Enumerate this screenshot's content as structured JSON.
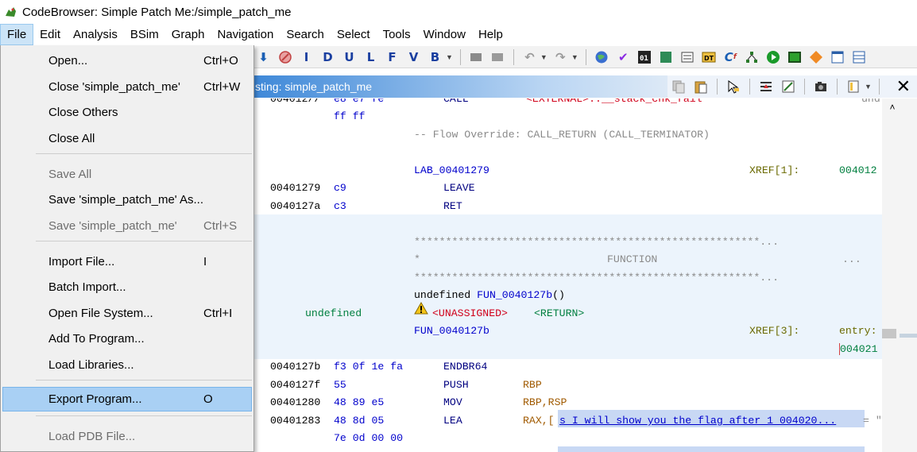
{
  "window": {
    "title": "CodeBrowser: Simple Patch Me:/simple_patch_me"
  },
  "menubar": {
    "items": [
      "File",
      "Edit",
      "Analysis",
      "BSim",
      "Graph",
      "Navigation",
      "Search",
      "Select",
      "Tools",
      "Window",
      "Help"
    ]
  },
  "file_menu": {
    "items": [
      {
        "label": "Open...",
        "shortcut": "Ctrl+O",
        "enabled": true
      },
      {
        "label": "Close 'simple_patch_me'",
        "shortcut": "Ctrl+W",
        "enabled": true
      },
      {
        "label": "Close Others",
        "shortcut": "",
        "enabled": true
      },
      {
        "label": "Close All",
        "shortcut": "",
        "enabled": true
      },
      {
        "label": "Save All",
        "shortcut": "",
        "enabled": false
      },
      {
        "label": "Save 'simple_patch_me' As...",
        "shortcut": "",
        "enabled": true
      },
      {
        "label": "Save 'simple_patch_me'",
        "shortcut": "Ctrl+S",
        "enabled": false
      },
      {
        "label": "Import File...",
        "shortcut": "I",
        "enabled": true
      },
      {
        "label": "Batch Import...",
        "shortcut": "",
        "enabled": true
      },
      {
        "label": "Open File System...",
        "shortcut": "Ctrl+I",
        "enabled": true
      },
      {
        "label": "Add To Program...",
        "shortcut": "",
        "enabled": true
      },
      {
        "label": "Load Libraries...",
        "shortcut": "",
        "enabled": true
      },
      {
        "label": "Export Program...",
        "shortcut": "O",
        "enabled": true,
        "selected": true
      },
      {
        "label": "Load PDB File...",
        "shortcut": "",
        "enabled": false
      }
    ]
  },
  "toolbar": {
    "letter_buttons": [
      "I",
      "D",
      "U",
      "L",
      "F",
      "V",
      "B"
    ]
  },
  "listing": {
    "title": "sting:  simple_patch_me",
    "lines": {
      "l0_addr": "004012//",
      "l0_bytes": "e8 e7 fe",
      "l0_mnem": "CALL",
      "l0_op": "<EXTERNAL>::__stack_chk_fail",
      "l0_tail": "und",
      "l1_bytes": "ff ff",
      "l2_comment": "-- Flow Override: CALL_RETURN (CALL_TERMINATOR)",
      "l3_label": "LAB_00401279",
      "l3_xref": "XREF[1]:",
      "l3_xref_addr": "004012",
      "l4_addr": "00401279",
      "l4_bytes": "c9",
      "l4_mnem": "LEAVE",
      "l5_addr": "0040127a",
      "l5_bytes": "c3",
      "l5_mnem": "RET",
      "l6_stars": "*******************************************************...",
      "l7_star": "*",
      "l7_func": "FUNCTION",
      "l7_dots": "...",
      "l8_stars": "*******************************************************...",
      "l9_sig_type": "undefined ",
      "l9_sig_name": "FUN_0040127b",
      "l9_sig_args": "()",
      "l10_type": "undefined",
      "l10_unassigned": "<UNASSIGNED>",
      "l10_return": "<RETURN>",
      "l11_label": "FUN_0040127b",
      "l11_xref": "XREF[3]:",
      "l11_entry": "entry:",
      "l11_addr2": "004021",
      "l12_addr": "0040127b",
      "l12_bytes": "f3 0f 1e fa",
      "l12_mnem": "ENDBR64",
      "l13_addr": "0040127f",
      "l13_bytes": "55",
      "l13_mnem": "PUSH",
      "l13_op": "RBP",
      "l14_addr": "00401280",
      "l14_bytes": "48 89 e5",
      "l14_mnem": "MOV",
      "l14_op": "RBP,RSP",
      "l15_addr": "00401283",
      "l15_bytes": "48 8d 05",
      "l15_mnem": "LEA",
      "l15_op": "RAX,[",
      "l15_ref": "s_I_will_show_you_the_flag_after_1_004020...",
      "l15_tail": "= \"",
      "l16_bytes": "7e 0d 00 00"
    }
  },
  "colors": {
    "menu_selected": "#a9d0f4",
    "listing_title_gradient_start": "#3e88d8",
    "function_band": "#ecf4fc",
    "address_blue": "#0000cc",
    "undefined_green": "#007f3f",
    "unassigned_red": "#d0001a"
  }
}
